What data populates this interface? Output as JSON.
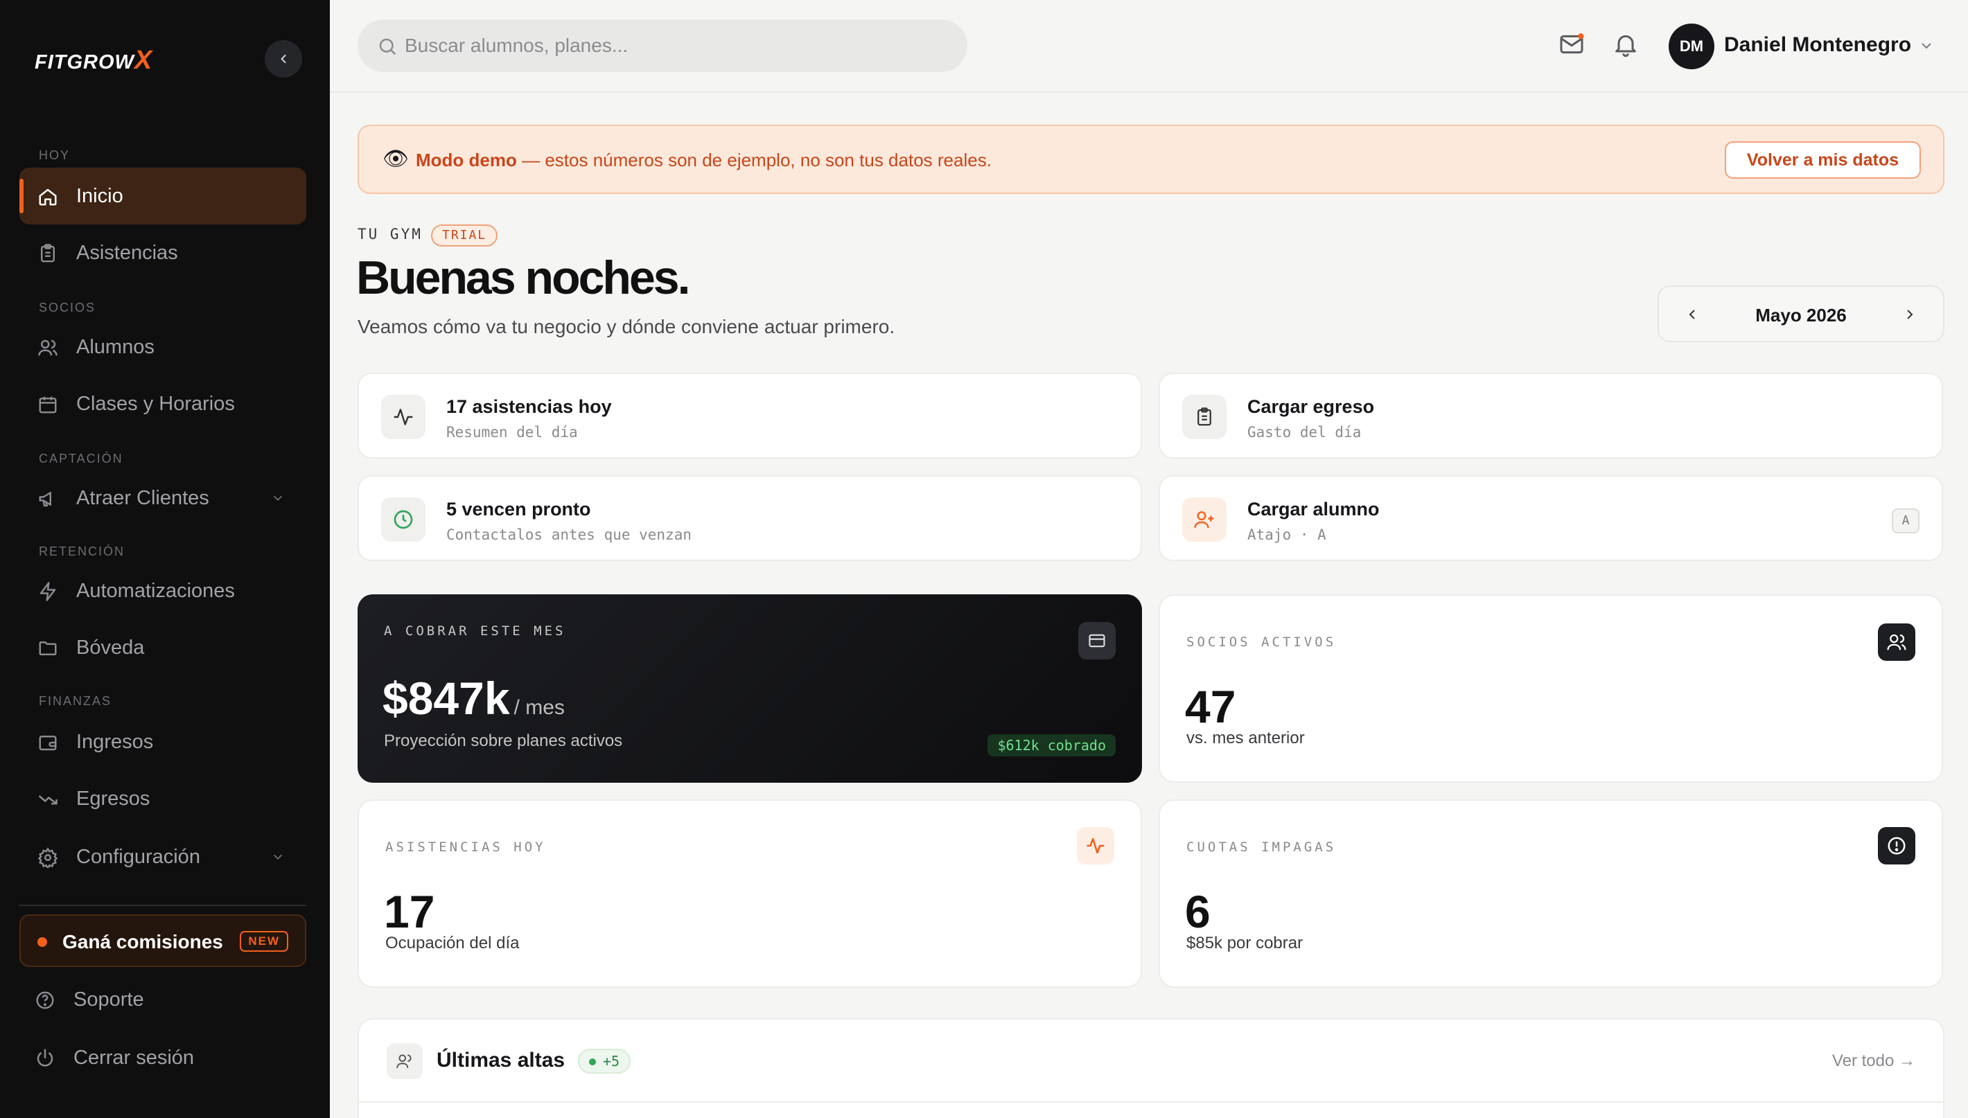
{
  "brand": {
    "name": "FITGROW",
    "mark": "X"
  },
  "sidebar": {
    "sections": [
      "HOY",
      "SOCIOS",
      "CAPTACIÓN",
      "RETENCIÓN",
      "FINANZAS"
    ],
    "items": [
      {
        "label": "Inicio",
        "icon": "home-icon"
      },
      {
        "label": "Asistencias",
        "icon": "clipboard-icon"
      },
      {
        "label": "Alumnos",
        "icon": "users-icon"
      },
      {
        "label": "Clases y Horarios",
        "icon": "calendar-icon"
      },
      {
        "label": "Atraer Clientes",
        "icon": "megaphone-icon"
      },
      {
        "label": "Automatizaciones",
        "icon": "bolt-icon"
      },
      {
        "label": "Bóveda",
        "icon": "folder-icon"
      },
      {
        "label": "Ingresos",
        "icon": "wallet-icon"
      },
      {
        "label": "Egresos",
        "icon": "trend-down-icon"
      },
      {
        "label": "Configuración",
        "icon": "gear-icon"
      }
    ],
    "promo": {
      "label": "Ganá comisiones",
      "badge": "NEW"
    },
    "support": "Soporte",
    "logout": "Cerrar sesión"
  },
  "topbar": {
    "search_placeholder": "Buscar alumnos, planes...",
    "user": {
      "initials": "DM",
      "name": "Daniel Montenegro"
    }
  },
  "banner": {
    "bold": "Modo demo",
    "text": " — estos números son de ejemplo, no son tus datos reales.",
    "button": "Volver a mis datos"
  },
  "header": {
    "eyebrow": "TU GYM",
    "badge": "TRIAL",
    "title": "Buenas noches.",
    "subtitle": "Veamos cómo va tu negocio y dónde conviene actuar primero.",
    "month": "Mayo 2026"
  },
  "quick": [
    {
      "title": "17 asistencias hoy",
      "sub": "Resumen del día"
    },
    {
      "title": "Cargar egreso",
      "sub": "Gasto del día"
    },
    {
      "title": "5 vencen pronto",
      "sub": "Contactalos antes que venzan"
    },
    {
      "title": "Cargar alumno",
      "sub": "Atajo · A",
      "key": "A"
    }
  ],
  "stats": {
    "cobrar": {
      "label": "A COBRAR ESTE MES",
      "value": "$847k",
      "unit": "/ mes",
      "sub": "Proyección sobre planes activos",
      "pill": "$612k cobrado"
    },
    "socios": {
      "label": "SOCIOS ACTIVOS",
      "value": "47",
      "sub": "vs. mes anterior"
    },
    "asistencias": {
      "label": "ASISTENCIAS HOY",
      "value": "17",
      "sub": "Ocupación del día"
    },
    "cuotas": {
      "label": "CUOTAS IMPAGAS",
      "value": "6",
      "sub": "$85k por cobrar"
    }
  },
  "altas": {
    "title": "Últimas altas",
    "badge": "+5",
    "link": "Ver todo →"
  },
  "colors": {
    "accent": "#f2601c",
    "sidebar": "#0f0f10",
    "banner_bg": "#fde9dc",
    "banner_text": "#c8461a",
    "success": "#2fa85a"
  }
}
